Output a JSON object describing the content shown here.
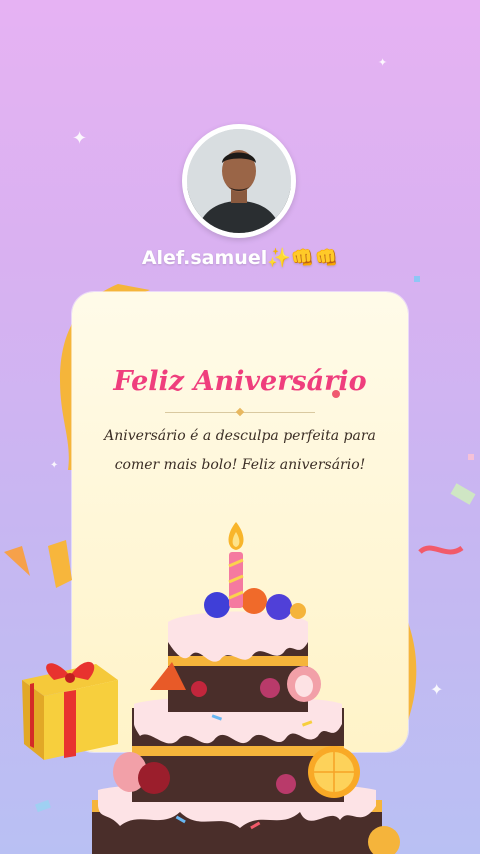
{
  "profile": {
    "username": "Alef.samuel✨👊👊"
  },
  "card": {
    "title": "Feliz Aniversário",
    "message_line1": "Aniversário é a desculpa perfeita para",
    "message_line2": "comer mais bolo! Feliz aniversário!"
  },
  "colors": {
    "title": "#ef3e7d",
    "background_top": "#e6b2f3",
    "background_bottom": "#b9c0f3",
    "card": "#fff8dc"
  },
  "icons": [
    "sparkle-icon",
    "gift-box-icon",
    "birthday-cake-icon",
    "candle-icon",
    "confetti-icon"
  ]
}
